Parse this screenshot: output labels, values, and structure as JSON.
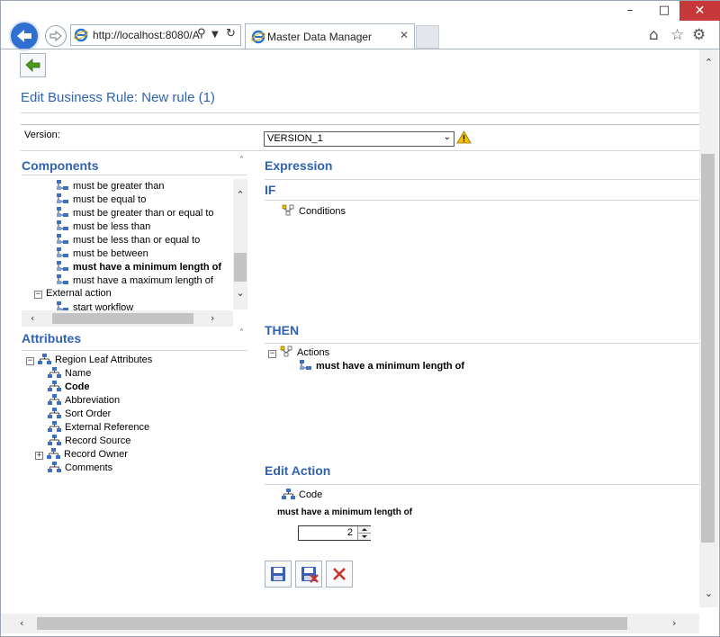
{
  "browser": {
    "url": "http://localhost:8080/A",
    "tab_title": "Master Data Manager"
  },
  "page": {
    "title": "Edit Business Rule: New rule (1)",
    "version_label": "Version:",
    "version_value": "VERSION_1"
  },
  "components": {
    "heading": "Components",
    "items": [
      "must be greater than",
      "must be equal to",
      "must be greater than or equal to",
      "must be less than",
      "must be less than or equal to",
      "must be between",
      "must have a minimum length of",
      "must have a maximum length of"
    ],
    "group_external": "External action",
    "external_item": "start workflow"
  },
  "attributes": {
    "heading": "Attributes",
    "root": "Region Leaf Attributes",
    "items": [
      "Name",
      "Code",
      "Abbreviation",
      "Sort Order",
      "External Reference",
      "Record Source",
      "Record Owner",
      "Comments"
    ]
  },
  "expression": {
    "heading": "Expression",
    "if_label": "IF",
    "conditions_label": "Conditions",
    "then_label": "THEN",
    "actions_label": "Actions",
    "action_item": "must have a minimum length of"
  },
  "edit_action": {
    "heading": "Edit Action",
    "attribute": "Code",
    "rule_label": "must have a minimum length of",
    "value": "2"
  },
  "colors": {
    "accent": "#2f62b0",
    "ie_blue": "#2f6fd0",
    "close_red": "#c7383b",
    "delete_red": "#c8362b"
  }
}
